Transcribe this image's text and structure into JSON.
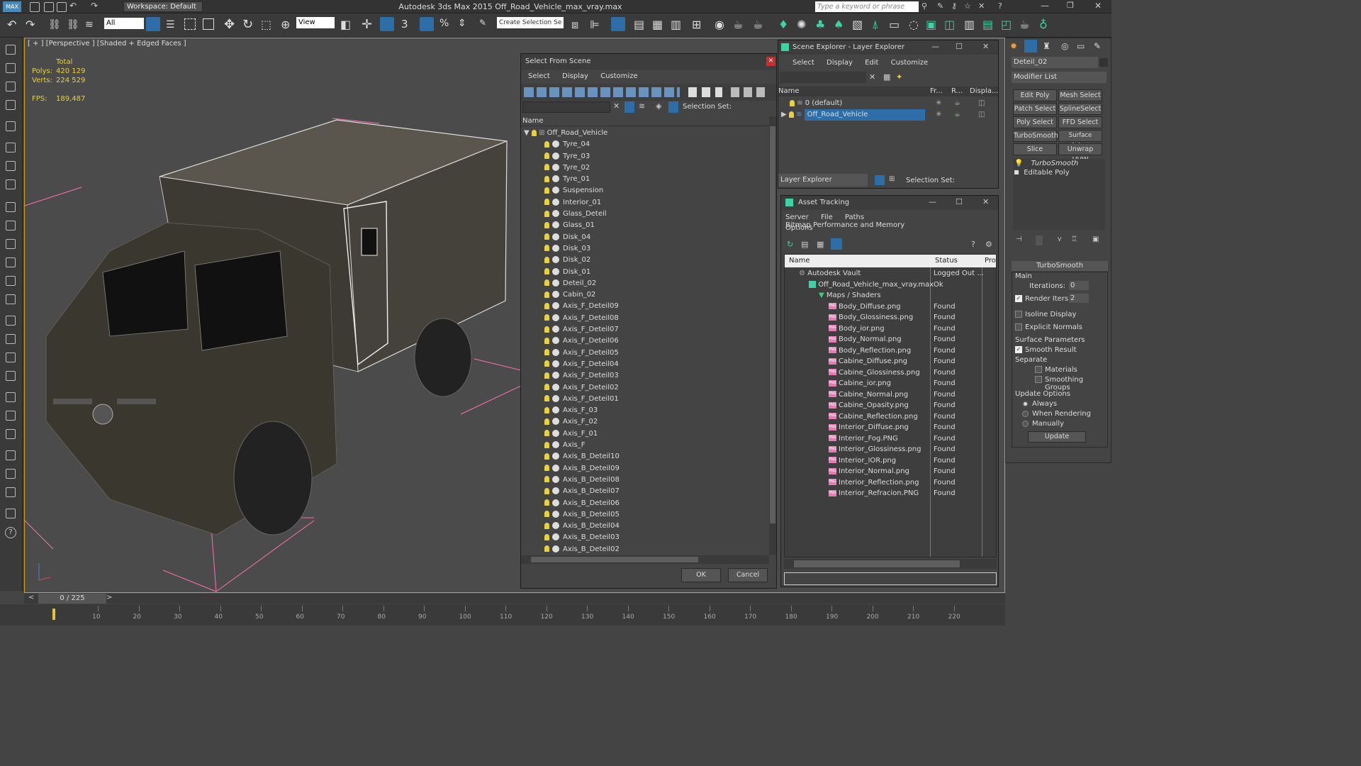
{
  "app": {
    "workspace_label": "Workspace: Default",
    "title": "Autodesk 3ds Max  2015    Off_Road_Vehicle_max_vray.max",
    "search_placeholder": "Type a keyword or phrase"
  },
  "toolbar": {
    "filter_all": "All",
    "view_dropdown": "View",
    "create_selection_set": "Create Selection Se"
  },
  "viewport": {
    "label": "[ + ] [Perspective ] [Shaded + Edged Faces ]",
    "stats_total": "Total",
    "polys_label": "Polys:",
    "polys_value": "420 129",
    "verts_label": "Verts:",
    "verts_value": "224 529",
    "fps_label": "FPS:",
    "fps_value": "189,487",
    "time_slider": "0 / 225"
  },
  "timeline": {
    "ticks": [
      "10",
      "20",
      "30",
      "40",
      "50",
      "60",
      "70",
      "80",
      "90",
      "100",
      "110",
      "120",
      "130",
      "140",
      "150",
      "160",
      "170",
      "180",
      "190",
      "200",
      "210",
      "220"
    ]
  },
  "select_from_scene": {
    "title": "Select From Scene",
    "menu": [
      "Select",
      "Display",
      "Customize"
    ],
    "selection_set_label": "Selection Set:",
    "column_name": "Name",
    "root": "Off_Road_Vehicle",
    "items": [
      "Tyre_04",
      "Tyre_03",
      "Tyre_02",
      "Tyre_01",
      "Suspension",
      "Interior_01",
      "Glass_Deteil",
      "Glass_01",
      "Disk_04",
      "Disk_03",
      "Disk_02",
      "Disk_01",
      "Deteil_02",
      "Cabin_02",
      "Axis_F_Deteil09",
      "Axis_F_Deteil08",
      "Axis_F_Deteil07",
      "Axis_F_Deteil06",
      "Axis_F_Deteil05",
      "Axis_F_Deteil04",
      "Axis_F_Deteil03",
      "Axis_F_Deteil02",
      "Axis_F_Deteil01",
      "Axis_F_03",
      "Axis_F_02",
      "Axis_F_01",
      "Axis_F",
      "Axis_B_Deteil10",
      "Axis_B_Deteil09",
      "Axis_B_Deteil08",
      "Axis_B_Deteil07",
      "Axis_B_Deteil06",
      "Axis_B_Deteil05",
      "Axis_B_Deteil04",
      "Axis_B_Deteil03",
      "Axis_B_Deteil02"
    ],
    "ok_label": "OK",
    "cancel_label": "Cancel"
  },
  "scene_explorer": {
    "title": "Scene Explorer - Layer Explorer",
    "menu": [
      "Select",
      "Display",
      "Edit",
      "Customize"
    ],
    "columns": [
      "Name",
      "Fr...",
      "R...",
      "Displa..."
    ],
    "rows": [
      "0 (default)",
      "Off_Road_Vehicle"
    ],
    "footer_dropdown": "Layer Explorer",
    "selection_set_label": "Selection Set:"
  },
  "asset_tracking": {
    "title": "Asset Tracking",
    "menu": [
      "Server",
      "File",
      "Paths",
      "Bitmap Performance and Memory"
    ],
    "menu2": "Options",
    "columns": [
      "Name",
      "Status",
      "Pro"
    ],
    "vault": {
      "name": "Autodesk Vault",
      "status": "Logged Out ..."
    },
    "file": {
      "name": "Off_Road_Vehicle_max_vray.max",
      "status": "Ok"
    },
    "maps_folder": "Maps / Shaders",
    "maps": [
      {
        "name": "Body_Diffuse.png",
        "status": "Found"
      },
      {
        "name": "Body_Glossiness.png",
        "status": "Found"
      },
      {
        "name": "Body_ior.png",
        "status": "Found"
      },
      {
        "name": "Body_Normal.png",
        "status": "Found"
      },
      {
        "name": "Body_Reflection.png",
        "status": "Found"
      },
      {
        "name": "Cabine_Diffuse.png",
        "status": "Found"
      },
      {
        "name": "Cabine_Glossiness.png",
        "status": "Found"
      },
      {
        "name": "Cabine_ior.png",
        "status": "Found"
      },
      {
        "name": "Cabine_Normal.png",
        "status": "Found"
      },
      {
        "name": "Cabine_Opasity.png",
        "status": "Found"
      },
      {
        "name": "Cabine_Reflection.png",
        "status": "Found"
      },
      {
        "name": "Interior_Diffuse.png",
        "status": "Found"
      },
      {
        "name": "Interior_Fog.PNG",
        "status": "Found"
      },
      {
        "name": "Interior_Glossiness.png",
        "status": "Found"
      },
      {
        "name": "Interior_IOR.png",
        "status": "Found"
      },
      {
        "name": "Interior_Normal.png",
        "status": "Found"
      },
      {
        "name": "Interior_Reflection.png",
        "status": "Found"
      },
      {
        "name": "Interior_Refracion.PNG",
        "status": "Found"
      }
    ]
  },
  "command_panel": {
    "object_name": "Deteil_02",
    "modifier_list": "Modifier List",
    "buttons": [
      "Edit Poly",
      "Mesh Select",
      "Patch Select",
      "SplineSelect",
      "Poly Select",
      "FFD Select",
      "TurboSmooth",
      "Surface Select",
      "Slice",
      "Unwrap UVW"
    ],
    "stack": [
      "TurboSmooth",
      "Editable Poly"
    ],
    "rollout_title": "TurboSmooth",
    "main_label": "Main",
    "iterations_label": "Iterations:",
    "iterations_value": "0",
    "render_iters_label": "Render Iters:",
    "render_iters_value": "2",
    "isoline_label": "Isoline Display",
    "explicit_label": "Explicit Normals",
    "surface_label": "Surface Parameters",
    "smooth_label": "Smooth Result",
    "separate_label": "Separate",
    "materials_label": "Materials",
    "smoothing_label": "Smoothing Groups",
    "update_options_label": "Update Options",
    "always_label": "Always",
    "when_rendering_label": "When Rendering",
    "manually_label": "Manually",
    "update_button": "Update"
  }
}
